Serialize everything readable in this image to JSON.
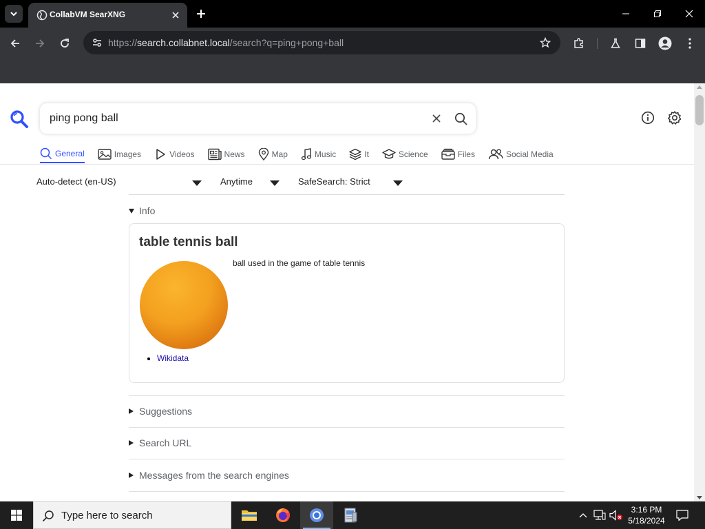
{
  "browser": {
    "tab_title": "CollabVM SearXNG",
    "url_scheme": "https://",
    "url_host": "search.collabnet.local",
    "url_path": "/search?q=ping+pong+ball"
  },
  "search": {
    "query": "ping pong ball"
  },
  "categories": [
    {
      "label": "General",
      "icon": "search-icon",
      "active": true
    },
    {
      "label": "Images",
      "icon": "image-icon"
    },
    {
      "label": "Videos",
      "icon": "play-icon"
    },
    {
      "label": "News",
      "icon": "newspaper-icon"
    },
    {
      "label": "Map",
      "icon": "map-pin-icon"
    },
    {
      "label": "Music",
      "icon": "music-note-icon"
    },
    {
      "label": "It",
      "icon": "layers-icon"
    },
    {
      "label": "Science",
      "icon": "graduation-cap-icon"
    },
    {
      "label": "Files",
      "icon": "files-icon"
    },
    {
      "label": "Social Media",
      "icon": "people-icon"
    }
  ],
  "filters": {
    "language": "Auto-detect (en-US)",
    "time_range": "Anytime",
    "safesearch": "SafeSearch: Strict"
  },
  "info": {
    "section_label": "Info",
    "title": "table tennis ball",
    "description": "ball used in the game of table tennis",
    "link_label": "Wikidata",
    "image_color": "#f39f1f"
  },
  "sections": {
    "suggestions": "Suggestions",
    "search_url": "Search URL",
    "messages": "Messages from the search engines"
  },
  "taskbar": {
    "search_placeholder": "Type here to search",
    "time": "3:16 PM",
    "date": "5/18/2024"
  },
  "colors": {
    "accent": "#3050ff",
    "link": "#1a0dab",
    "chrome_dark": "#35363a"
  }
}
